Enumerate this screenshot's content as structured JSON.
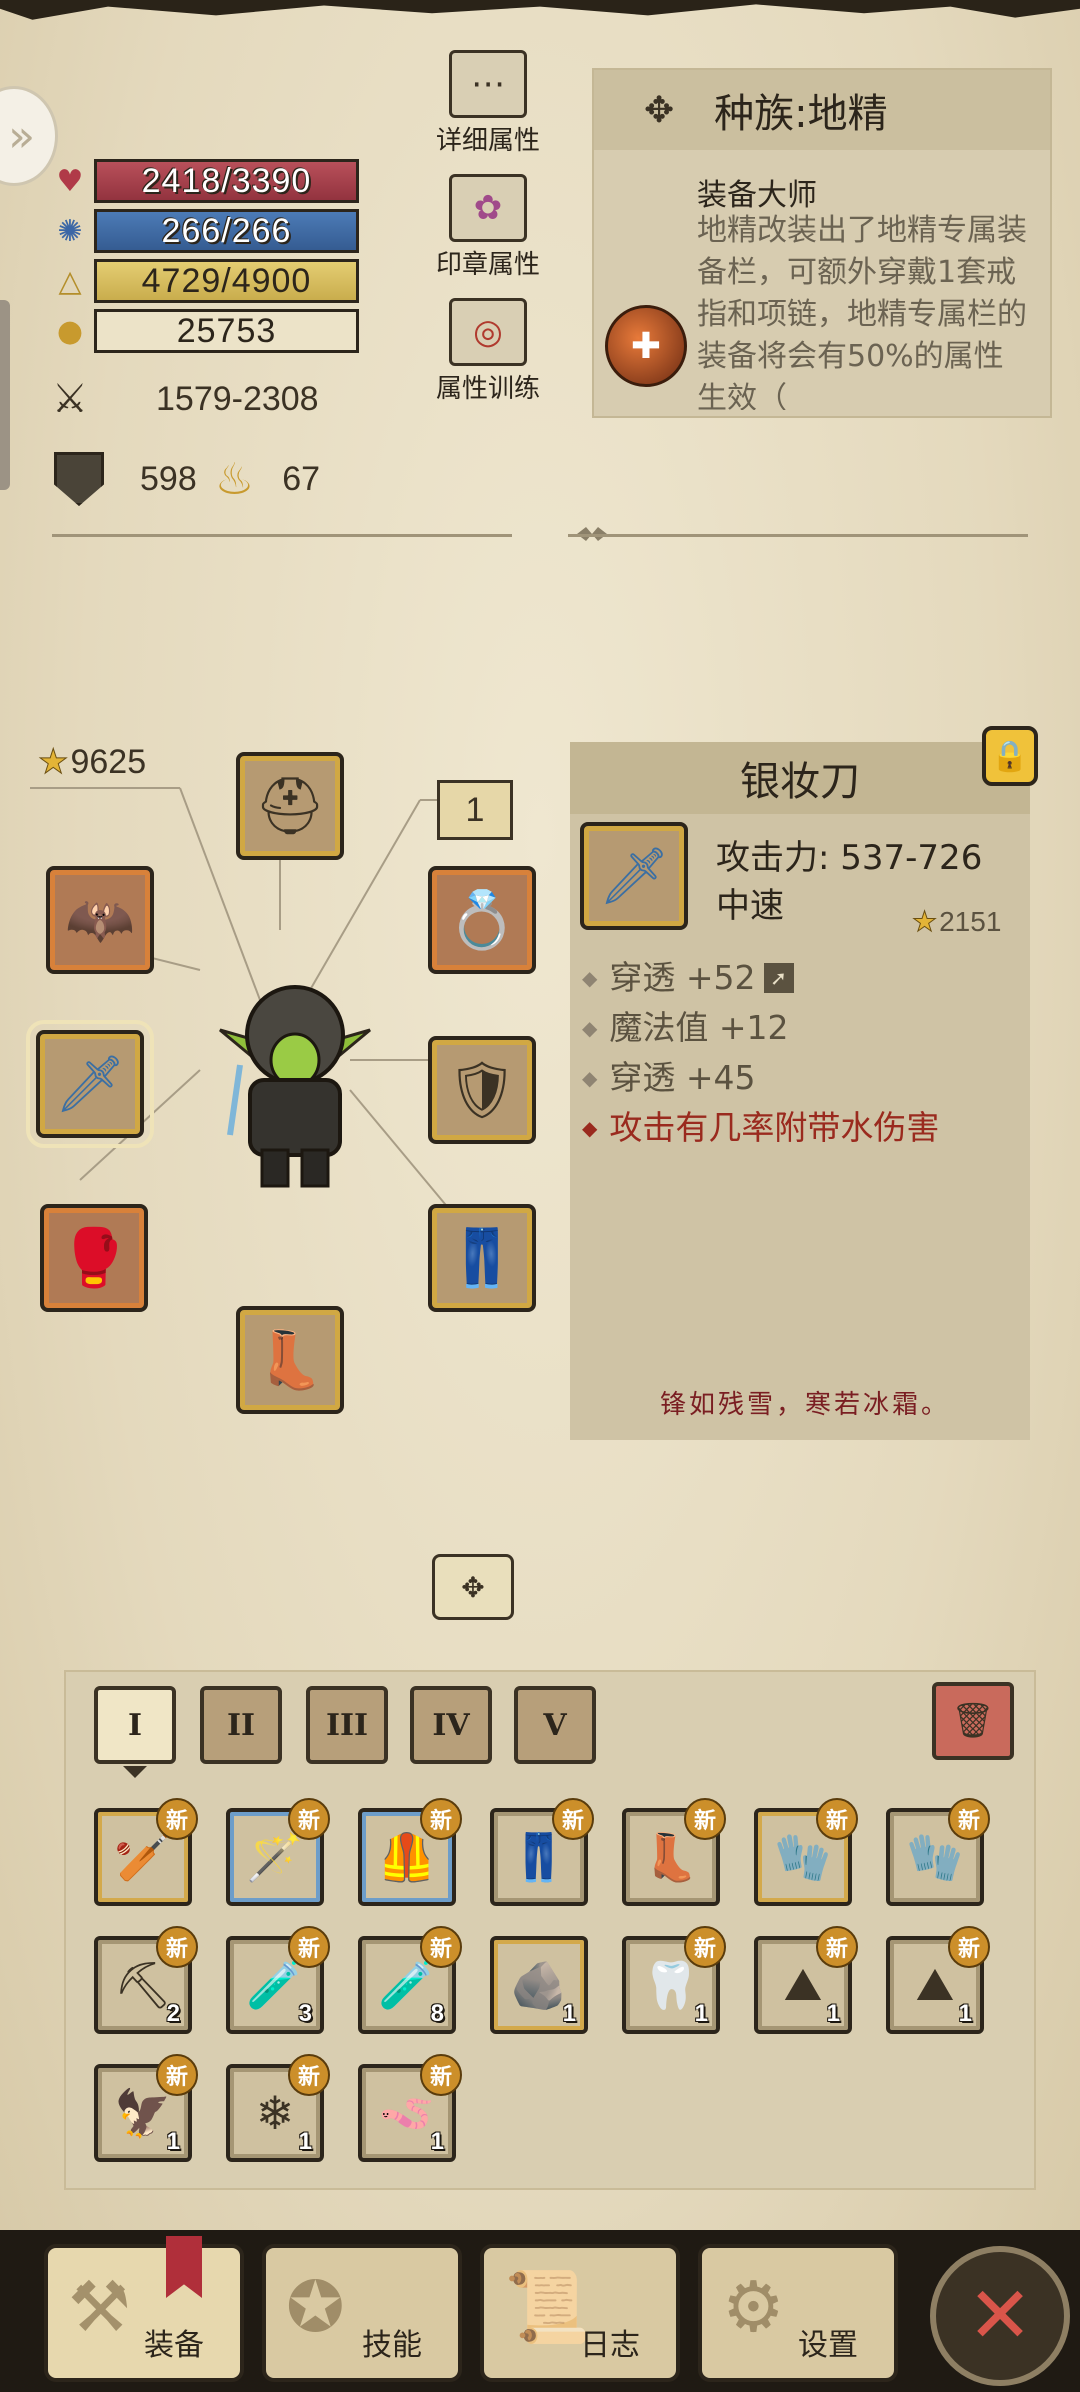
{
  "stats": {
    "hp": "2418/3390",
    "mp": "266/266",
    "xp": "4729/4900",
    "gold": "25753",
    "attack": "1579-2308",
    "armor": "598",
    "magic_resist": "67"
  },
  "attribute_buttons": {
    "detail": "详细属性",
    "seal": "印章属性",
    "training": "属性训练"
  },
  "race": {
    "header": "种族:地精",
    "trait_title": "装备大师",
    "trait_desc": "地精改装出了地精专属装备栏，可额外穿戴1套戒指和项链，地精专属栏的装备将会有50%的属性生效（"
  },
  "equipment": {
    "total_score": "9625",
    "ring_set_count": "1"
  },
  "item_detail": {
    "name": "银妆刀",
    "attack": "攻击力: 537-726",
    "speed": "中速",
    "score": "2151",
    "attributes": [
      "穿透 +52",
      "魔法值 +12",
      "穿透 +45"
    ],
    "special": "攻击有几率附带水伤害",
    "quote": "锋如残雪，寒若冰霜。"
  },
  "inventory": {
    "tabs": [
      "I",
      "II",
      "III",
      "IV",
      "V"
    ],
    "new_label": "新",
    "items": [
      {
        "icon": "spiked-club-icon",
        "glyph": "🏏"
      },
      {
        "icon": "wooden-staff-icon",
        "glyph": "🪄"
      },
      {
        "icon": "chainmail-vest-icon",
        "glyph": "🦺"
      },
      {
        "icon": "leather-pants-icon",
        "glyph": "👖"
      },
      {
        "icon": "leather-boots-icon",
        "glyph": "👢"
      },
      {
        "icon": "gauntlet-icon",
        "glyph": "🧤"
      },
      {
        "icon": "leather-glove-icon",
        "glyph": "🧤"
      },
      {
        "icon": "pickaxe-icon",
        "glyph": "⛏",
        "qty": "2"
      },
      {
        "icon": "red-potion-icon",
        "glyph": "🧪",
        "qty": "3"
      },
      {
        "icon": "blue-potion-icon",
        "glyph": "🧪",
        "qty": "8"
      },
      {
        "icon": "blue-ore-icon",
        "glyph": "🪨",
        "qty": "1"
      },
      {
        "icon": "fang-icon",
        "glyph": "🦷",
        "qty": "1"
      },
      {
        "icon": "stone-pile-icon",
        "glyph": "⛰",
        "qty": "1"
      },
      {
        "icon": "ash-pile-icon",
        "glyph": "⛰",
        "qty": "1"
      },
      {
        "icon": "claw-icon",
        "glyph": "🦅",
        "qty": "1"
      },
      {
        "icon": "snowflake-icon",
        "glyph": "❄",
        "qty": "1"
      },
      {
        "icon": "worm-icon",
        "glyph": "🪱",
        "qty": "1"
      }
    ]
  },
  "nav": {
    "equipment": "装备",
    "skills": "技能",
    "log": "日志",
    "settings": "设置"
  }
}
